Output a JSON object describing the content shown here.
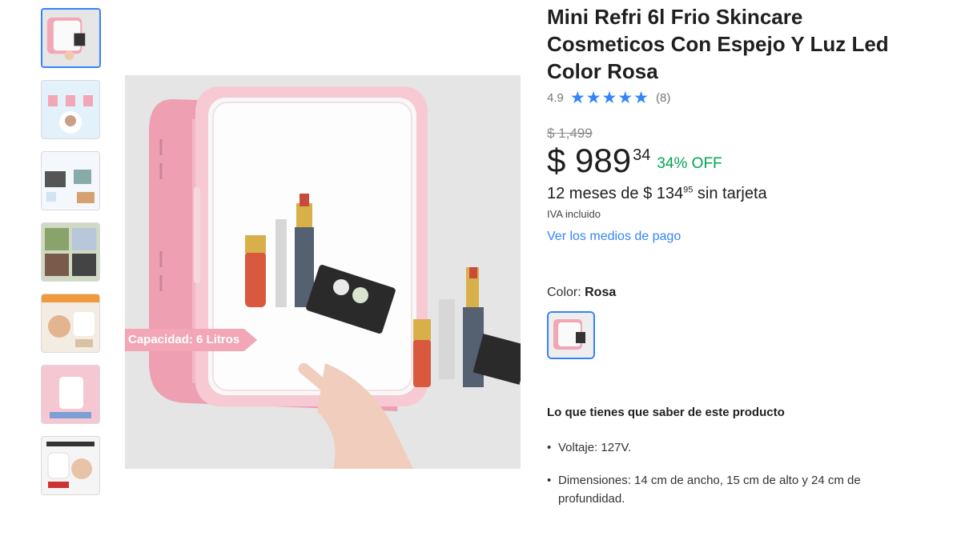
{
  "gallery": {
    "thumbnails": [
      {
        "name": "thumbnail-1",
        "selected": true
      },
      {
        "name": "thumbnail-2",
        "selected": false
      },
      {
        "name": "thumbnail-3",
        "selected": false
      },
      {
        "name": "thumbnail-4",
        "selected": false
      },
      {
        "name": "thumbnail-5",
        "selected": false
      },
      {
        "name": "thumbnail-6",
        "selected": false
      },
      {
        "name": "thumbnail-7",
        "selected": false
      }
    ],
    "main_badge": "Capacidad: 6 Litros"
  },
  "product": {
    "title": "Mini Refri 6l Frio Skincare Cosmeticos Con Espejo Y Luz Led Color Rosa",
    "rating": "4.9",
    "stars": "★★★★★",
    "reviews": "(8)",
    "original_price": "$ 1,499",
    "price_main": "$ 989",
    "price_cents": "34",
    "discount": "34% OFF",
    "installments_prefix": "12 meses de $ 134",
    "installments_cents": "95",
    "installments_suffix": " sin tarjeta",
    "iva": "IVA incluido",
    "payment_link": "Ver los medios de pago",
    "color_label": "Color: ",
    "color_value": "Rosa",
    "know_title": "Lo que tienes que saber de este producto",
    "specs": [
      "Voltaje: 127V.",
      "Dimensiones: 14 cm de ancho, 15 cm de alto y 24 cm de profundidad."
    ]
  },
  "colors": {
    "accent": "#3483fa",
    "discount": "#00a650",
    "product_pink": "#f2a6b6"
  }
}
